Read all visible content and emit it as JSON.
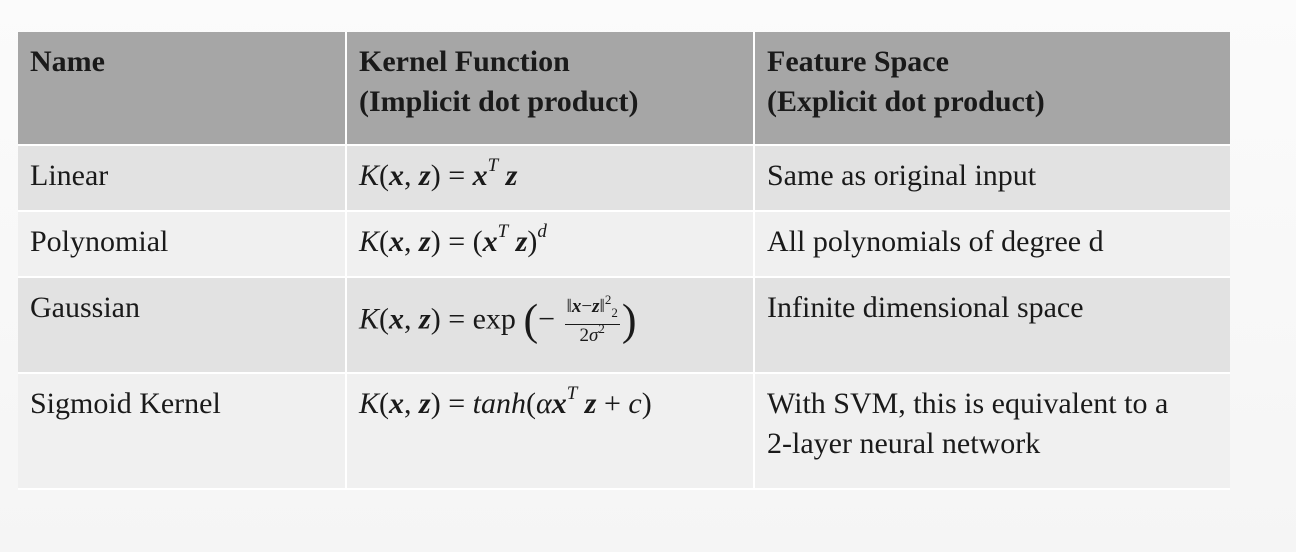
{
  "header": {
    "name": "Name",
    "kernel_line1": "Kernel Function",
    "kernel_line2": "(Implicit dot product)",
    "feature_line1": "Feature Space",
    "feature_line2": "(Explicit dot product)"
  },
  "rows": [
    {
      "name": "Linear",
      "formula": "K(x, z) = xᵀz",
      "feature": "Same as original input"
    },
    {
      "name": "Polynomial",
      "formula": "K(x, z) = (xᵀz)ᵈ",
      "feature": "All polynomials of degree d"
    },
    {
      "name": "Gaussian",
      "formula": "K(x, z) = exp(−‖x−z‖₂² / 2σ²)",
      "feature": "Infinite dimensional space"
    },
    {
      "name": "Sigmoid Kernel",
      "formula": "K(x, z) = tanh(αxᵀz + c)",
      "feature_line1": "With SVM, this is equivalent to a",
      "feature_line2": "2-layer neural network"
    }
  ]
}
